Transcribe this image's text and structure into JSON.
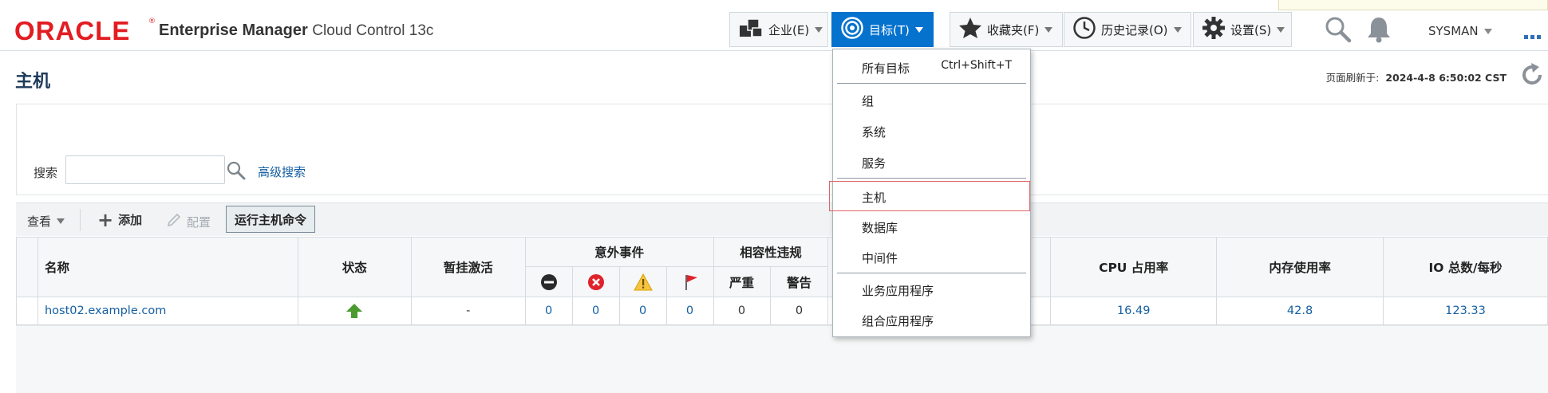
{
  "header": {
    "logo_text": "ORACLE",
    "logo_mark": "®",
    "product_bold": "Enterprise Manager",
    "product_light": "Cloud Control 13c",
    "nav": {
      "enterprise": "企业(E)",
      "targets": "目标(T)",
      "favorites": "收藏夹(F)",
      "history": "历史记录(O)",
      "setup": "设置(S)"
    },
    "user": "SYSMAN",
    "icons": {
      "enterprise": "enterprise-icon",
      "targets": "target-icon",
      "favorites": "star-icon",
      "history": "clock-icon",
      "setup": "gear-icon",
      "search": "search-icon",
      "notifications": "bell-icon",
      "more": "more-icon"
    },
    "accent_color": "#0572ce",
    "brand_color": "#e21d22"
  },
  "page": {
    "title": "主机",
    "refresh_label": "页面刷新于:",
    "refresh_time": "2024-4-8 6:50:02 CST"
  },
  "search": {
    "label": "搜索",
    "value": "",
    "advanced": "高级搜索"
  },
  "toolbar": {
    "view": "查看",
    "add": "添加",
    "configure": "配置",
    "run_command": "运行主机命令"
  },
  "table": {
    "headers": {
      "name": "名称",
      "status": "状态",
      "blackout": "暂挂激活",
      "incidents": "意外事件",
      "compliance": "相容性违规",
      "severe": "严重",
      "warning": "警告",
      "cpu": "CPU 占用率",
      "memory": "内存使用率",
      "io": "IO 总数/每秒"
    },
    "incident_icons": [
      "fatal-icon",
      "critical-icon",
      "warning-icon",
      "escalated-flag-icon"
    ],
    "rows": [
      {
        "name": "host02.example.com",
        "status": "up",
        "blackout": "-",
        "incident_fatal": "0",
        "incident_critical": "0",
        "incident_warning": "0",
        "incident_escalated": "0",
        "compliance_severe": "0",
        "compliance_warning": "0",
        "cpu": "16.49",
        "memory": "42.8",
        "io": "123.33"
      }
    ]
  },
  "targets_menu": {
    "all_targets": "所有目标",
    "all_targets_shortcut": "Ctrl+Shift+T",
    "groups": "组",
    "systems": "系统",
    "services": "服务",
    "hosts": "主机",
    "databases": "数据库",
    "middleware": "中间件",
    "business_apps": "业务应用程序",
    "composite_apps": "组合应用程序",
    "highlighted_item": "主机"
  }
}
